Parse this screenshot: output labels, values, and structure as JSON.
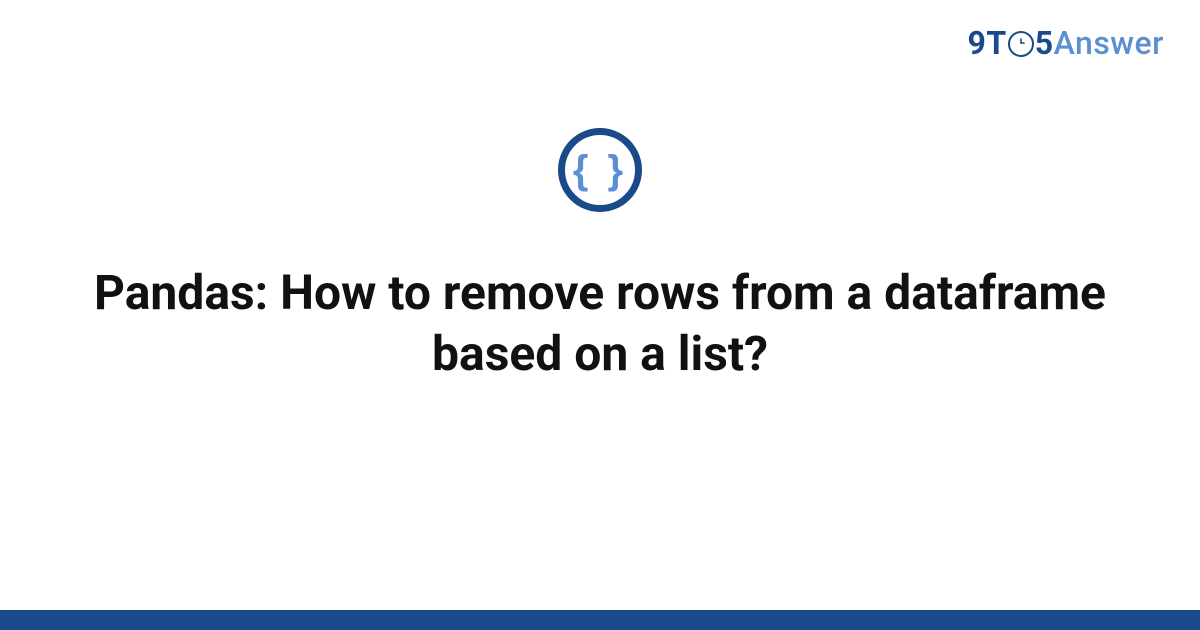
{
  "logo": {
    "prefix": "9T",
    "clock_glyph": "⟨⟩",
    "mid": "5",
    "suffix": "Answer"
  },
  "center_icon": {
    "glyph": "{ }",
    "name": "code-braces"
  },
  "title": "Pandas: How to remove rows from a dataframe based on a list?",
  "colors": {
    "brand_dark": "#1a4a8a",
    "brand_light": "#5a8fd4"
  }
}
